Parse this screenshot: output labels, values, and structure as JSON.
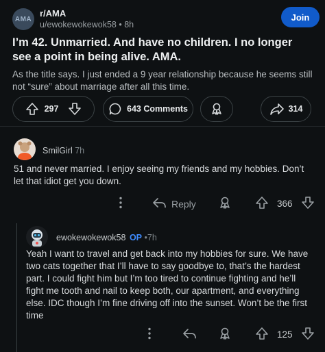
{
  "post": {
    "subreddit": "r/AMA",
    "subreddit_avatar_text": "AMA",
    "author": "u/ewokewokewok58",
    "separator": "•",
    "age": "8h",
    "join_label": "Join",
    "title": "I’m 42. Unmarried. And have no children. I no longer see a point in being alive. AMA.",
    "body": "As the title says. I just ended a 9 year relationship because he seems still not “sure” about marriage after all this time.",
    "upvotes": "297",
    "comments_label": "643 Comments",
    "shares": "314"
  },
  "comments": [
    {
      "username": "SmilGirl",
      "age": "7h",
      "text": "51 and never married. I enjoy seeing my friends and my hobbies. Don’t let that idiot get you down.",
      "reply_label": "Reply",
      "votes": "366"
    },
    {
      "username": "ewokewokewok58",
      "op_badge": "OP",
      "separator": "•",
      "age": "7h",
      "text": "Yeah I want to travel and get back into my hobbies for sure. We have two cats together that I’ll have to say goodbye to, that’s the hardest part. I could fight him but I’m too tired to continue fighting and he’ll fight me tooth and nail to keep both, our apartment, and everything else. IDC though I’m fine driving off into the sunset. Won’t be the first time",
      "votes": "125"
    }
  ],
  "colors": {
    "background": "#0e1113",
    "join": "#115bca",
    "op_badge": "#3f8cff"
  },
  "icons": [
    "upvote-icon",
    "downvote-icon",
    "comment-icon",
    "award-icon",
    "share-icon",
    "more-icon",
    "reply-icon"
  ]
}
